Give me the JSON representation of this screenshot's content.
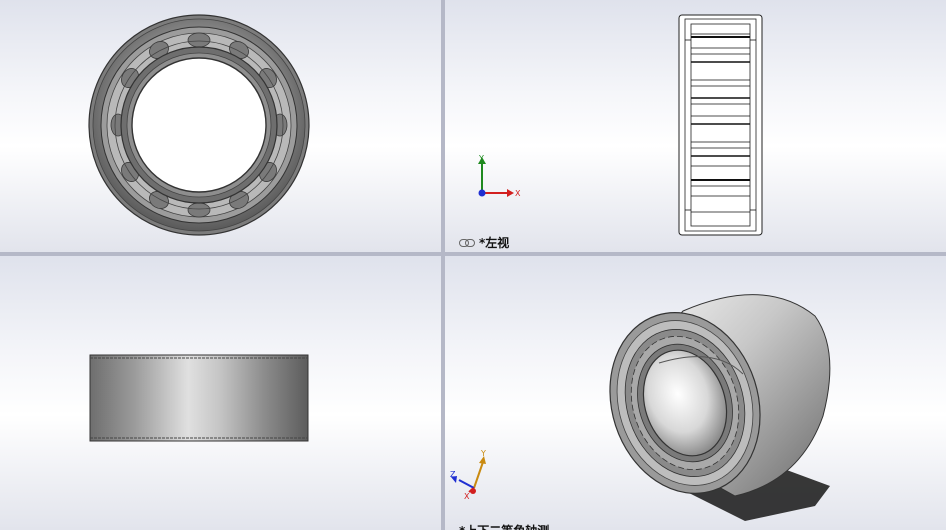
{
  "viewports": {
    "top_left": {
      "name": "front-view",
      "label": ""
    },
    "top_right": {
      "name": "left-view",
      "label": "*左视",
      "linked": true
    },
    "bottom_left": {
      "name": "top-view",
      "label": ""
    },
    "bottom_right": {
      "name": "isometric-view",
      "label": "*上下二等角轴测"
    }
  },
  "triad_axes": {
    "x": "X",
    "y": "Y",
    "z": "Z"
  },
  "colors": {
    "divider": "#b5b8c7",
    "x_axis": "#d21f1f",
    "y_axis": "#1f8a1f",
    "z_axis": "#1f2fd2",
    "part_dark": "#555555",
    "part_mid": "#9a9a9a",
    "part_light": "#d6d6d6"
  }
}
